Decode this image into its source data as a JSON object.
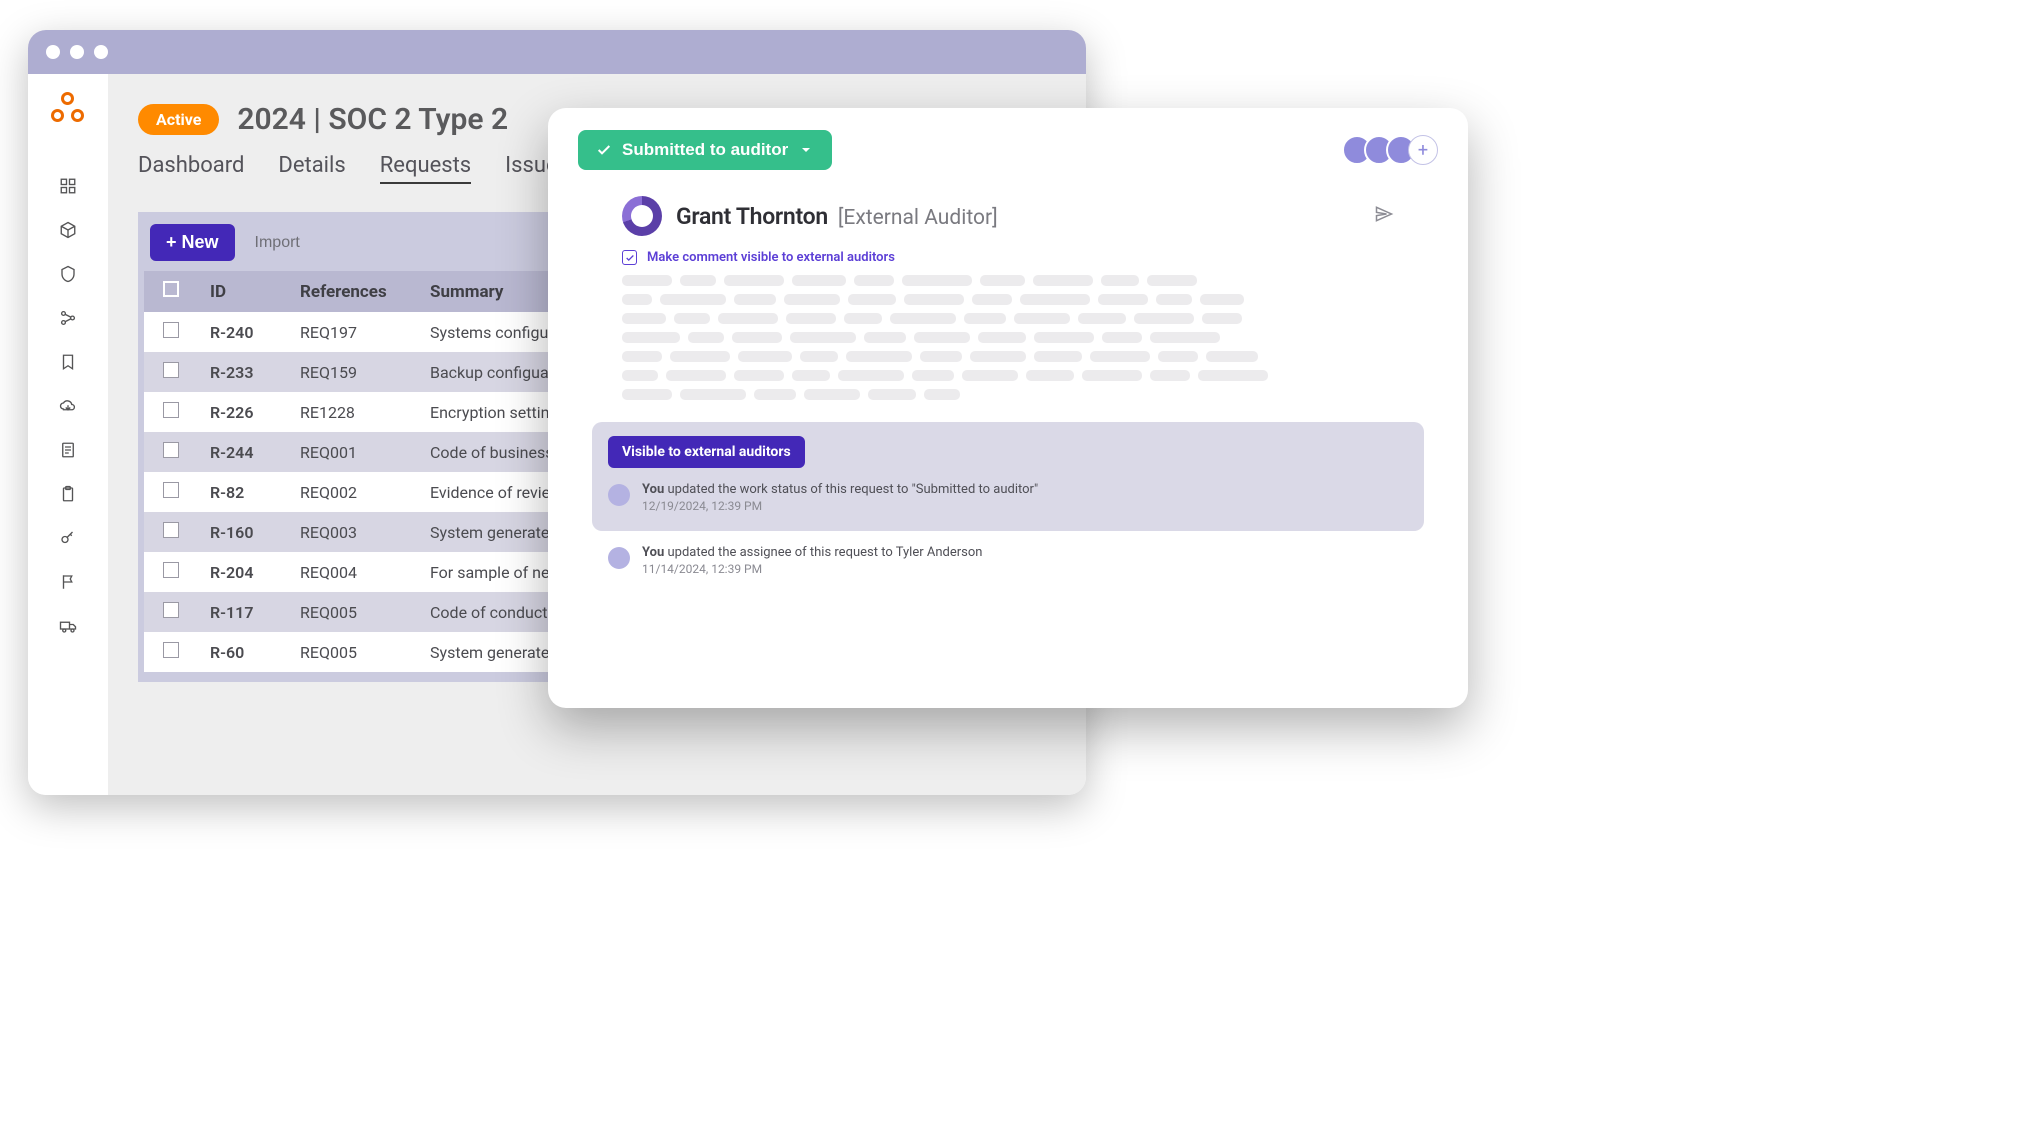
{
  "page": {
    "status_badge": "Active",
    "title": "2024 | SOC 2 Type 2"
  },
  "tabs": {
    "dashboard": "Dashboard",
    "details": "Details",
    "requests": "Requests",
    "issues": "Issues"
  },
  "toolbar": {
    "new_label": "+  New",
    "import_label": "Import"
  },
  "table": {
    "headers": {
      "id": "ID",
      "references": "References",
      "summary": "Summary"
    },
    "rows": [
      {
        "id": "R-240",
        "ref": "REQ197",
        "summary": "Systems configuration for passw…"
      },
      {
        "id": "R-233",
        "ref": "REQ159",
        "summary": "Backup configuaration & schedu…"
      },
      {
        "id": "R-226",
        "ref": "RE1228",
        "summary": "Encryption settings for all data st…"
      },
      {
        "id": "R-244",
        "ref": "REQ001",
        "summary": "Code of business conduct & ethic…"
      },
      {
        "id": "R-82",
        "ref": "REQ002",
        "summary": "Evidence of review and approval…"
      },
      {
        "id": "R-160",
        "ref": "REQ003",
        "summary": "System generated list of new hire…"
      },
      {
        "id": "R-204",
        "ref": "REQ004",
        "summary": "For sample of new hires, evidenc…"
      },
      {
        "id": "R-117",
        "ref": "REQ005",
        "summary": "Code of conduct"
      },
      {
        "id": "R-60",
        "ref": "REQ005",
        "summary": "System generated report of customer & workforce member…"
      }
    ]
  },
  "panel": {
    "status_label": "Submitted to auditor",
    "auditor_name": "Grant Thornton",
    "auditor_role": "[External Auditor]",
    "visibility_checkbox": "Make comment visible to external auditors",
    "visibility_badge": "Visible to external auditors",
    "log1_who": "You",
    "log1_text": " updated the work status of this request to \"Submitted to auditor\"",
    "log1_ts": "12/19/2024, 12:39 PM",
    "log2_who": "You",
    "log2_text": " updated the assignee of this request to Tyler Anderson",
    "log2_ts": "11/14/2024, 12:39 PM"
  }
}
